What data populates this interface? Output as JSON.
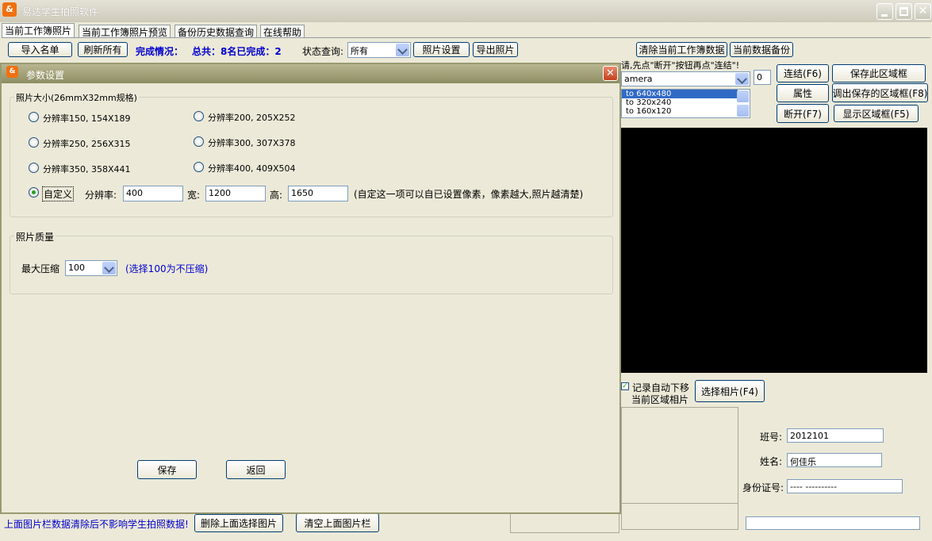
{
  "app": {
    "title": "易达学生拍照软件",
    "tabs": [
      "当前工作簿照片",
      "当前工作簿照片预览",
      "备份历史数据查询",
      "在线帮助"
    ]
  },
  "toolbar": {
    "import_label": "导入名单",
    "refresh_label": "刷新所有",
    "completion_label": "完成情况：",
    "completion_value": "总共：8名已完成：2",
    "status_label": "状态查询:",
    "status_value": "所有",
    "photo_settings_label": "照片设置",
    "export_label": "导出照片",
    "clear_label": "清除当前工作簿数据",
    "backup_label": "当前数据备份"
  },
  "camera": {
    "hint": "请,先点\"断开\"按钮再点\"连结\"!",
    "device": "amera",
    "device_index": "0",
    "resolutions": [
      "to 640x480",
      "to 320x240",
      "to 160x120"
    ],
    "connect_label": "连结(F6)",
    "properties_label": "属性",
    "disconnect_label": "断开(F7)",
    "save_region_label": "保存此区域框",
    "load_region_label": "调出保存的区域框(F8)",
    "show_region_label": "显示区域框(F5)"
  },
  "record": {
    "auto_move_label": "记录自动下移",
    "current_photo_label": "当前区域相片",
    "select_photo_label": "选择相片(F4)",
    "class_label": "班号:",
    "class_value": "2012101",
    "name_label": "姓名:",
    "name_value": "何佳乐",
    "id_label": "身份证号:",
    "id_value": "----      ----------"
  },
  "bottom": {
    "notice": "上面图片栏数据清除后不影响学生拍照数据!",
    "delete_label": "删除上面选择图片",
    "clear_label": "清空上面图片栏"
  },
  "dialog": {
    "title": "参数设置",
    "size_group": "照片大小(26mmX32mm规格)",
    "options": [
      "分辨率150, 154X189",
      "分辨率200, 205X252",
      "分辨率250, 256X315",
      "分辨率300, 307X378",
      "分辨率350, 358X441",
      "分辨率400, 409X504"
    ],
    "custom_label": "自定义",
    "resolution_label": "分辨率:",
    "resolution_value": "400",
    "width_label": "宽:",
    "width_value": "1200",
    "height_label": "高:",
    "height_value": "1650",
    "custom_hint": "(自定这一项可以自已设置像素，像素越大,照片越清楚)",
    "quality_group": "照片质量",
    "compress_label": "最大压缩",
    "compress_value": "100",
    "compress_hint": "(选择100为不压缩)",
    "save_label": "保存",
    "back_label": "返回"
  },
  "colors": {
    "titlebar": "#d6d3c4",
    "dialog_title": "#9a9a72",
    "accent_blue": "#0000cc",
    "preview": "#000000"
  }
}
